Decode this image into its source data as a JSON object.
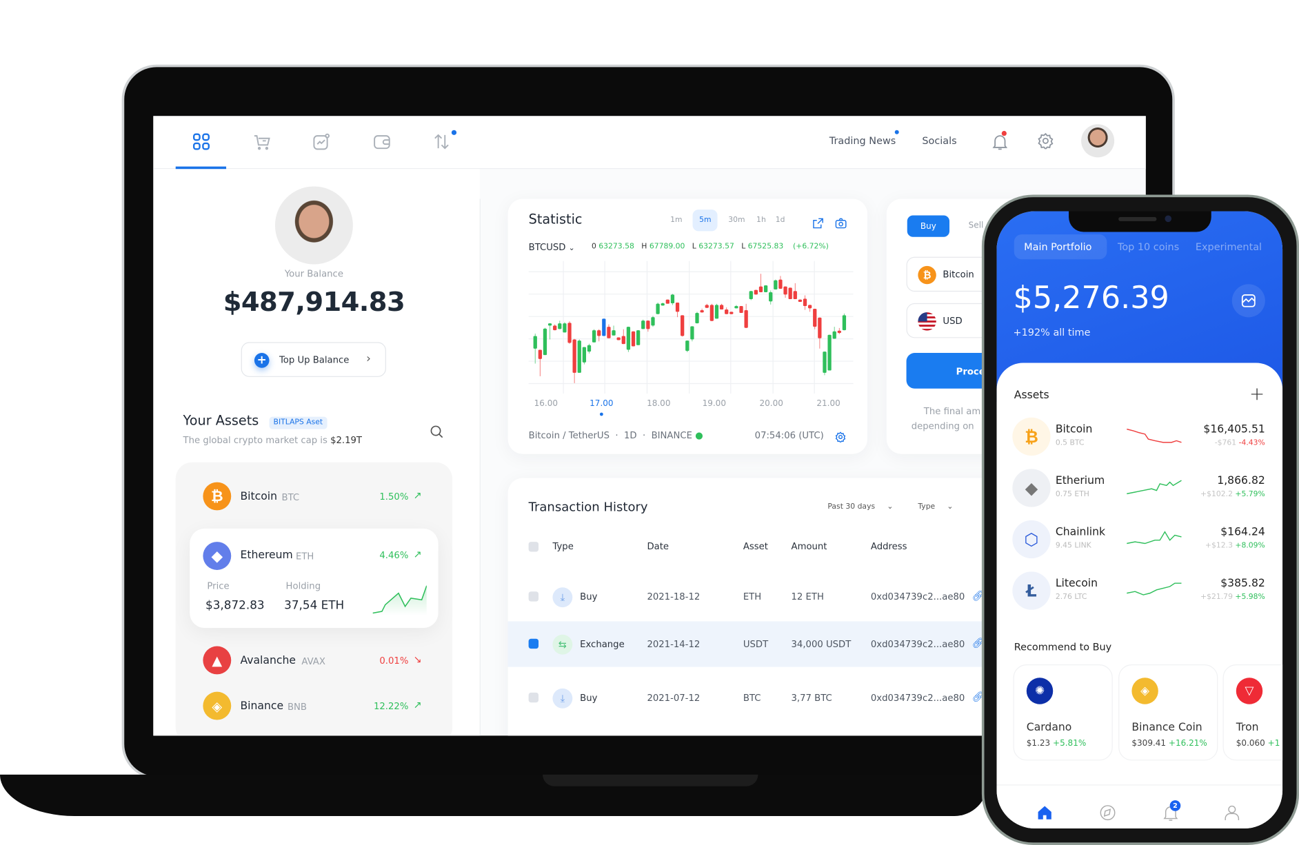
{
  "colors": {
    "accent": "#1a73e8",
    "up": "#2fbf5b",
    "down": "#ef3f3f",
    "phone_header": "#2264ee"
  },
  "laptop": {
    "nav": {
      "icons": [
        "dashboard-icon",
        "cart-icon",
        "chart-icon",
        "wallet-icon",
        "transfer-icon"
      ],
      "active_index": 0,
      "trading_news": "Trading News",
      "socials": "Socials"
    },
    "profile": {
      "balance_label": "Your Balance",
      "balance": "$487,914.83",
      "top_up": "Top Up Balance"
    },
    "assets_header": {
      "title": "Your Assets",
      "badge": "BITLAPS Aset",
      "subtitle": "The global crypto market cap is ",
      "market_cap": "$2.19T"
    },
    "assets": [
      {
        "name": "Bitcoin",
        "ticker": "BTC",
        "change": "1.50%",
        "trend": "up",
        "color": "#f7931a"
      },
      {
        "name": "Ethereum",
        "ticker": "ETH",
        "change": "4.46%",
        "trend": "up",
        "color": "#627eea",
        "price_label": "Price",
        "price": "$3,872.83",
        "holding_label": "Holding",
        "holding": "37,54 ETH"
      },
      {
        "name": "Avalanche",
        "ticker": "AVAX",
        "change": "0.01%",
        "trend": "down",
        "color": "#e84142"
      },
      {
        "name": "Binance",
        "ticker": "BNB",
        "change": "12.22%",
        "trend": "up",
        "color": "#f3ba2f"
      }
    ],
    "statistic": {
      "title": "Statistic",
      "intervals": [
        "1m",
        "5m",
        "30m",
        "1h",
        "1d"
      ],
      "active_interval": "5m",
      "symbol": "BTCUSD",
      "o_label": "0",
      "o": "63273.58",
      "h_label": "H",
      "h": "67789.00",
      "l_label": "L",
      "l": "63273.57",
      "l2_label": "L",
      "l2": "67525.83",
      "change": "(+6.72%)",
      "footer_pair": "Bitcoin / TetherUS",
      "footer_interval": "1D",
      "footer_exchange": "BINANCE",
      "footer_time": "07:54:06 (UTC)"
    },
    "trade": {
      "buy": "Buy",
      "sell": "Sell",
      "from": "Bitcoin",
      "to": "USD",
      "proceed": "Proceed",
      "note_line1": "The final am",
      "note_line2": "depending on"
    },
    "transactions": {
      "title": "Transaction History",
      "filter_period": "Past 30 days",
      "filter_type": "Type",
      "columns": [
        "Type",
        "Date",
        "Asset",
        "Amount",
        "Address"
      ],
      "rows": [
        {
          "type": "Buy",
          "date": "2021-18-12",
          "asset": "ETH",
          "amount": "12 ETH",
          "address": "0xd034739c2...ae80",
          "selected": false
        },
        {
          "type": "Exchange",
          "date": "2021-14-12",
          "asset": "USDT",
          "amount": "34,000 USDT",
          "address": "0xd034739c2...ae80",
          "selected": true
        },
        {
          "type": "Buy",
          "date": "2021-07-12",
          "asset": "BTC",
          "amount": "3,77 BTC",
          "address": "0xd034739c2...ae80",
          "selected": false
        }
      ]
    }
  },
  "chart_data": {
    "type": "candlestick",
    "symbol": "BTCUSD",
    "x_tick_labels": [
      "16.00",
      "17.00",
      "18.00",
      "19.00",
      "20.00",
      "21.00"
    ],
    "selected_tick": "17.00",
    "highlighted_candle": 14,
    "ylim": [
      63273,
      67789
    ],
    "grid": true,
    "candles_ohlc": [
      [
        64699,
        65320,
        64081,
        65222
      ],
      [
        64652,
        64652,
        63558,
        64271
      ],
      [
        64433,
        65560,
        64433,
        65526
      ],
      [
        65650,
        65745,
        65080,
        65745
      ],
      [
        65650,
        65700,
        65460,
        65460
      ],
      [
        65507,
        65850,
        65500,
        65745
      ],
      [
        65365,
        65790,
        65365,
        65745
      ],
      [
        65764,
        65830,
        64900,
        64937
      ],
      [
        65079,
        65100,
        63273,
        63701
      ],
      [
        63701,
        65080,
        63701,
        65032
      ],
      [
        64129,
        64766,
        64050,
        64766
      ],
      [
        64575,
        64900,
        64500,
        64842
      ],
      [
        64956,
        65500,
        64956,
        65460
      ],
      [
        65460,
        65500,
        65000,
        65222
      ],
      [
        65222,
        65935,
        65222,
        65935
      ],
      [
        65602,
        65700,
        65127,
        65127
      ],
      [
        65241,
        65650,
        65241,
        65460
      ],
      [
        65165,
        65165,
        65051,
        65051
      ],
      [
        65222,
        65500,
        64889,
        64889
      ],
      [
        64652,
        65602,
        64560,
        65602
      ],
      [
        65412,
        65412,
        64794,
        64794
      ],
      [
        64842,
        65460,
        64842,
        65460
      ],
      [
        65507,
        65900,
        65507,
        65859
      ],
      [
        65859,
        65859,
        65400,
        65507
      ],
      [
        65650,
        66050,
        65600,
        66001
      ],
      [
        66125,
        66600,
        66125,
        66553
      ],
      [
        66477,
        66600,
        66477,
        66572
      ],
      [
        66724,
        66724,
        66553,
        66553
      ],
      [
        66572,
        66960,
        66500,
        66933
      ],
      [
        66600,
        66600,
        66000,
        66220
      ],
      [
        66078,
        66078,
        65200,
        65222
      ],
      [
        64604,
        65032,
        64550,
        65032
      ],
      [
        65079,
        65621,
        65000,
        65621
      ],
      [
        65745,
        66220,
        65745,
        66173
      ],
      [
        66287,
        66350,
        66192,
        66192
      ],
      [
        66505,
        66550,
        66382,
        66382
      ],
      [
        66505,
        66550,
        65840,
        65840
      ],
      [
        65935,
        66550,
        65935,
        66505
      ],
      [
        66505,
        66550,
        66315,
        66315
      ],
      [
        66315,
        66400,
        66125,
        66125
      ],
      [
        66220,
        66220,
        66125,
        66125
      ],
      [
        66363,
        66500,
        66363,
        66458
      ],
      [
        66458,
        66458,
        66173,
        66173
      ],
      [
        66287,
        66550,
        65555,
        65555
      ],
      [
        66743,
        67076,
        66700,
        67076
      ],
      [
        67123,
        67123,
        66933,
        66933
      ],
      [
        67266,
        67789,
        67028,
        67028
      ],
      [
        67028,
        67313,
        67028,
        67313
      ],
      [
        66648,
        67100,
        66520,
        67028
      ],
      [
        67142,
        67550,
        67142,
        67523
      ],
      [
        67551,
        67700,
        67171,
        67171
      ],
      [
        67266,
        67266,
        66800,
        66933
      ],
      [
        67218,
        67218,
        66743,
        66743
      ],
      [
        67076,
        67400,
        66743,
        66743
      ],
      [
        66724,
        66724,
        66629,
        66629
      ],
      [
        66762,
        66900,
        66300,
        66458
      ],
      [
        66505,
        66505,
        66220,
        66363
      ],
      [
        66344,
        66344,
        65500,
        65602
      ],
      [
        65982,
        65982,
        64700,
        65127
      ],
      [
        63701,
        64575,
        63600,
        64575
      ],
      [
        63796,
        65269,
        63796,
        65269
      ],
      [
        65108,
        65600,
        65108,
        65412
      ],
      [
        65441,
        65550,
        65300,
        65346
      ],
      [
        65460,
        66150,
        65460,
        66078
      ]
    ]
  },
  "phone": {
    "tabs": [
      "Main Portfolio",
      "Top 10 coins",
      "Experimental"
    ],
    "active_tab": 0,
    "balance": "$5,276.39",
    "balance_change": "+192% all time",
    "assets_title": "Assets",
    "assets": [
      {
        "name": "Bitcoin",
        "amount": "0.5 BTC",
        "value": "$16,405.51",
        "delta": "-$761",
        "change": "-4.43%",
        "trend": "down"
      },
      {
        "name": "Etherium",
        "amount": "0.75 ETH",
        "value": "1,866.82",
        "delta": "+$102.2",
        "change": "+5.79%",
        "trend": "up"
      },
      {
        "name": "Chainlink",
        "amount": "9.45 LINK",
        "value": "$164.24",
        "delta": "+$12.3",
        "change": "+8.09%",
        "trend": "up"
      },
      {
        "name": "Litecoin",
        "amount": "2.76 LTC",
        "value": "$385.82",
        "delta": "+$21.79",
        "change": "+5.98%",
        "trend": "up"
      }
    ],
    "recommend_title": "Recommend to Buy",
    "recommend": [
      {
        "name": "Cardano",
        "price": "$1.23",
        "change": "+5.81%",
        "color": "#0d2fa8"
      },
      {
        "name": "Binance Coin",
        "price": "$309.41",
        "change": "+16.21%",
        "color": "#f3ba2f"
      },
      {
        "name": "Tron",
        "price": "$0.060",
        "change": "+1",
        "color": "#ef2b36"
      }
    ],
    "notification_count": "2",
    "bottom_nav": [
      "home-icon",
      "compass-icon",
      "bell-icon",
      "user-icon"
    ]
  }
}
